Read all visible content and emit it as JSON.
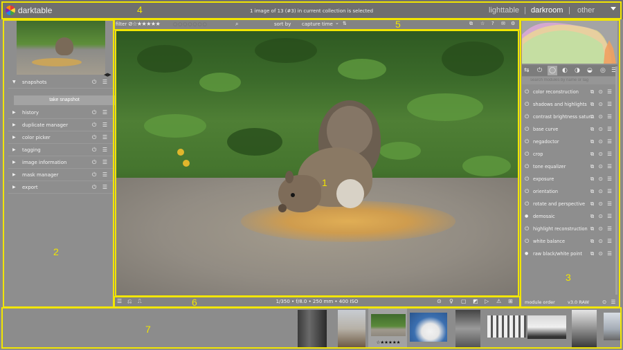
{
  "header": {
    "app_name": "darktable",
    "status": "1 image of 13 (#3) in current collection is selected",
    "views": [
      {
        "label": "lighttable",
        "active": false
      },
      {
        "label": "darkroom",
        "active": true
      },
      {
        "label": "other",
        "active": false
      }
    ],
    "separators": [
      "|",
      "|"
    ]
  },
  "left_panel": {
    "snapshots": {
      "label": "snapshots",
      "expanded": true,
      "button": "take snapshot"
    },
    "modules": [
      "history",
      "duplicate manager",
      "color picker",
      "tagging",
      "image information",
      "mask manager",
      "export"
    ],
    "row_icons": "⏻ ☰",
    "nav_expander": "◀▶"
  },
  "filter_bar": {
    "filter_label": "filter",
    "stars": "⊘☆★★★★★",
    "color_labels": "○○○○○○○",
    "search_icon": "⌕",
    "sort_label": "sort by",
    "sort_value": "capture time",
    "sort_caret": "⌄",
    "sort_dir_icon": "⇅",
    "right_icons": [
      "⧉",
      "☆",
      "?",
      "✉",
      "⚙"
    ]
  },
  "info_bar": {
    "exif": "1/350 • f/8.0 • 250 mm • 400 ISO",
    "left_icons": [
      "☰",
      "⎌",
      "⎍"
    ],
    "right_icons": [
      "⊙",
      "♀",
      "▢",
      "◩",
      "▷",
      "⚠",
      "⊞"
    ]
  },
  "right_panel": {
    "group_icons": [
      "⇆",
      "⏻",
      "◯",
      "◐",
      "◑",
      "◒",
      "◎",
      "☰"
    ],
    "search_placeholder": "search modules by name or tag",
    "search_icon": "⌕",
    "modules": [
      {
        "label": "color reconstruction",
        "power": "⏻"
      },
      {
        "label": "shadows and highlights",
        "power": "⏻"
      },
      {
        "label": "contrast brightness satur...",
        "power": "⏻"
      },
      {
        "label": "base curve",
        "power": "⏻"
      },
      {
        "label": "negadoctor",
        "power": "⏻"
      },
      {
        "label": "crop",
        "power": "⏻"
      },
      {
        "label": "tone equalizer",
        "power": "⏻"
      },
      {
        "label": "exposure",
        "power": "⏻"
      },
      {
        "label": "orientation",
        "power": "⏻"
      },
      {
        "label": "rotate and perspective",
        "power": "⏻"
      },
      {
        "label": "demosaic",
        "power": "●"
      },
      {
        "label": "highlight reconstruction",
        "power": "⏻"
      },
      {
        "label": "white balance",
        "power": "⏻"
      },
      {
        "label": "raw black/white point",
        "power": "●"
      }
    ],
    "module_icons": "⧉ ⊙ ☰",
    "module_order": {
      "label": "module order",
      "value": "v3.0 RAW",
      "icons": "⊙ ☰"
    }
  },
  "filmstrip": {
    "selected_index": 2,
    "selected_stars": "☆★★★★★",
    "thumb_count": 9
  },
  "overlay_labels": [
    "1",
    "2",
    "3",
    "4",
    "5",
    "6",
    "7"
  ],
  "colors": {
    "highlight_box": "#f2e600",
    "panel_bg": "#8e8e8e",
    "header_bg": "#6f6f6f"
  }
}
